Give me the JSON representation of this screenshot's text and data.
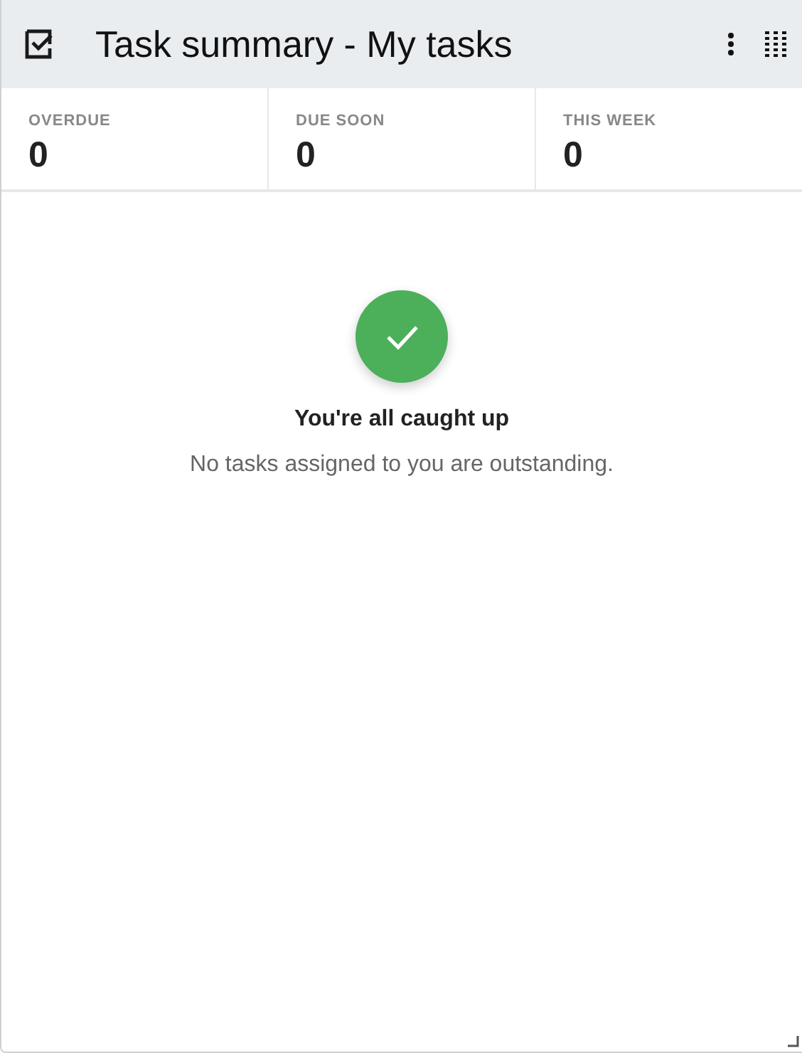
{
  "header": {
    "title": "Task summary - My tasks"
  },
  "stats": [
    {
      "label": "OVERDUE",
      "value": "0"
    },
    {
      "label": "DUE SOON",
      "value": "0"
    },
    {
      "label": "THIS WEEK",
      "value": "0"
    }
  ],
  "empty_state": {
    "title": "You're all caught up",
    "message": "No tasks assigned to you are outstanding."
  }
}
